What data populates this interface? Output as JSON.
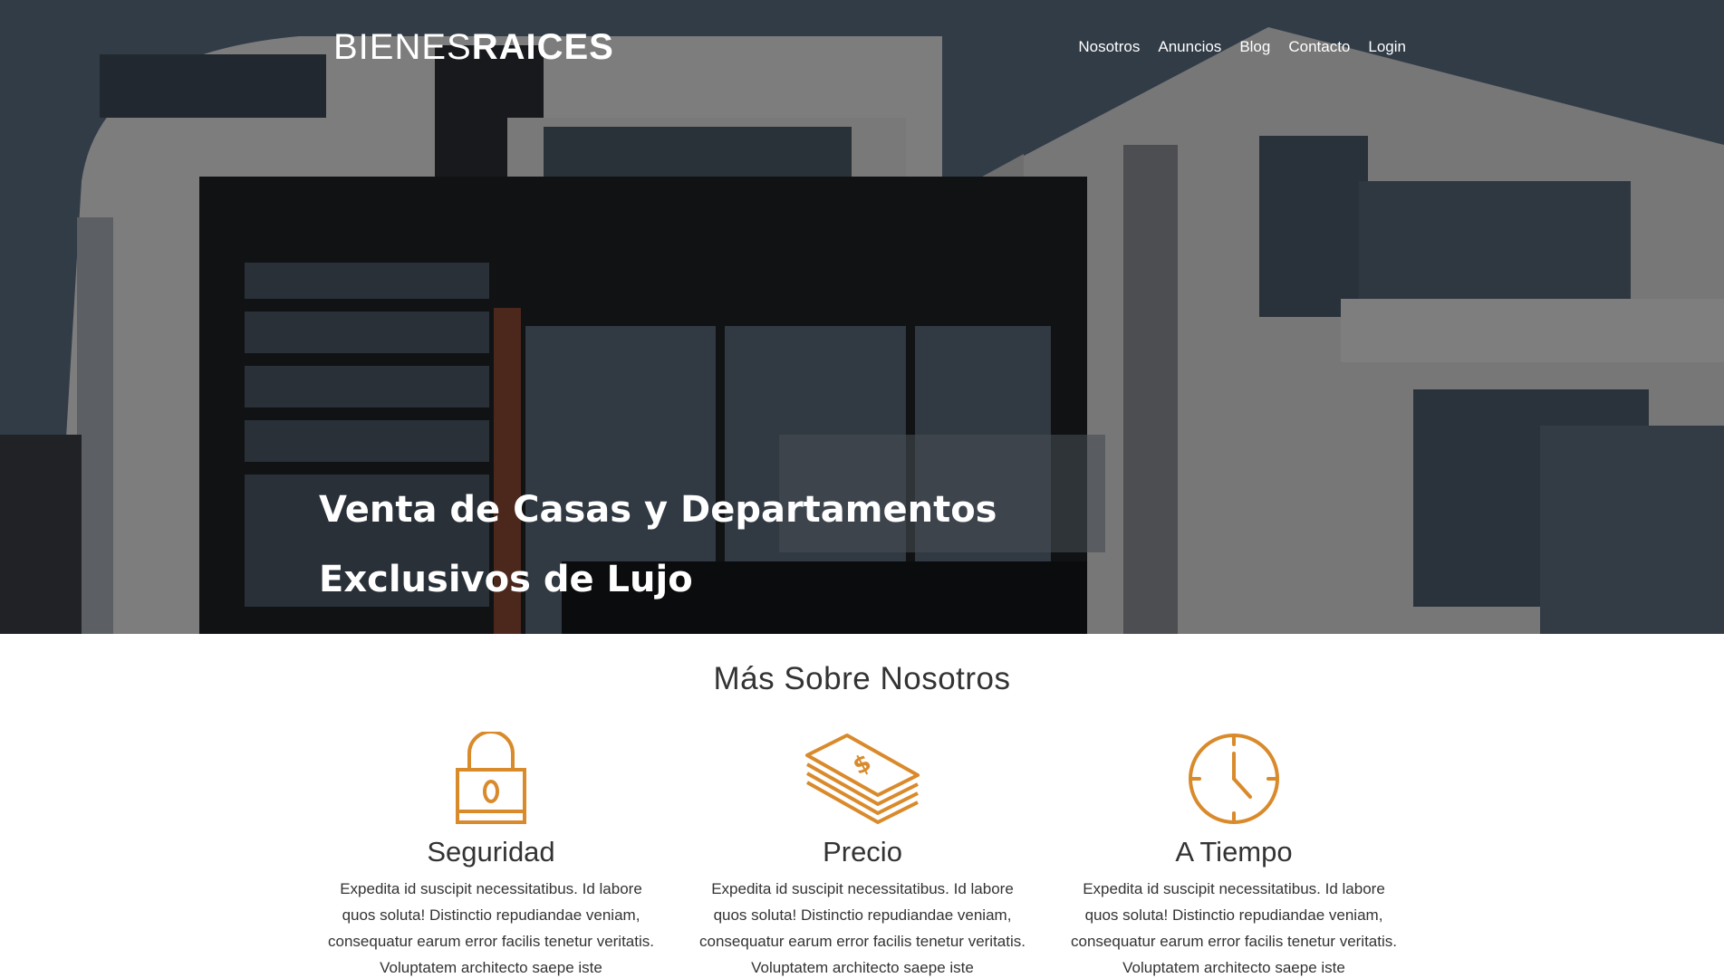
{
  "brand": {
    "name_light": "BIENES",
    "name_bold": "RAICES"
  },
  "nav": {
    "items": [
      "Nosotros",
      "Anuncios",
      "Blog",
      "Contacto",
      "Login"
    ]
  },
  "hero": {
    "title_line1": "Venta de Casas y Departamentos",
    "title_line2": "Exclusivos de Lujo"
  },
  "about": {
    "title": "Más Sobre Nosotros",
    "features": [
      {
        "icon": "lock-icon",
        "title": "Seguridad",
        "text": "Expedita id suscipit necessitatibus. Id labore quos soluta! Distinctio repudiandae veniam, consequatur earum error facilis tenetur veritatis. Voluptatem architecto saepe iste"
      },
      {
        "icon": "money-stack-icon",
        "title": "Precio",
        "text": "Expedita id suscipit necessitatibus. Id labore quos soluta! Distinctio repudiandae veniam, consequatur earum error facilis tenetur veritatis. Voluptatem architecto saepe iste"
      },
      {
        "icon": "clock-icon",
        "title": "A Tiempo",
        "text": "Expedita id suscipit necessitatibus. Id labore quos soluta! Distinctio repudiandae veniam, consequatur earum error facilis tenetur veritatis. Voluptatem architecto saepe iste"
      }
    ]
  },
  "colors": {
    "accent": "#d98a2b",
    "text": "#333333",
    "overlay": "rgba(0,0,0,0.45)"
  }
}
